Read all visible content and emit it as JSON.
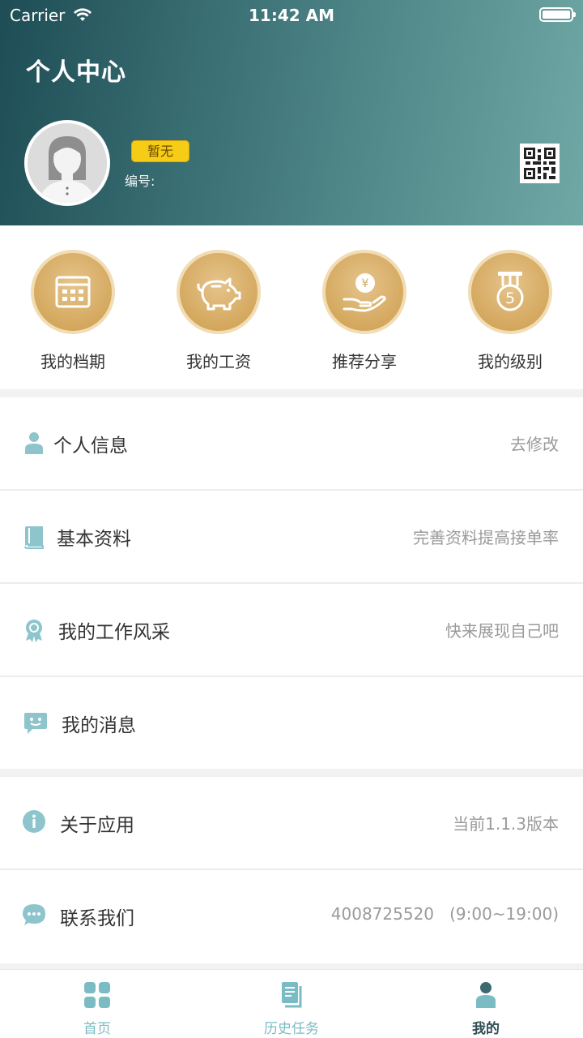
{
  "status_bar": {
    "carrier": "Carrier",
    "time": "11:42 AM"
  },
  "header": {
    "title": "个人中心",
    "level_badge": "暂无",
    "member_number_label": "编号:"
  },
  "quick_actions": [
    {
      "label": "我的档期",
      "icon": "calendar-icon"
    },
    {
      "label": "我的工资",
      "icon": "piggy-bank-icon"
    },
    {
      "label": "推荐分享",
      "icon": "hand-coin-icon"
    },
    {
      "label": "我的级别",
      "icon": "medal-icon"
    }
  ],
  "menu_group_1": [
    {
      "label": "个人信息",
      "hint": "去修改",
      "icon": "person-icon"
    },
    {
      "label": "基本资料",
      "hint": "完善资料提高接单率",
      "icon": "book-icon"
    },
    {
      "label": "我的工作风采",
      "hint": "快来展现自己吧",
      "icon": "award-icon"
    },
    {
      "label": "我的消息",
      "hint": "",
      "icon": "message-icon"
    }
  ],
  "menu_group_2": [
    {
      "label": "关于应用",
      "hint": "当前1.1.3版本",
      "icon": "info-icon"
    },
    {
      "label": "联系我们",
      "hint": "4008725520   (9:00~19:00)",
      "icon": "chat-icon"
    }
  ],
  "tab_bar": [
    {
      "label": "首页",
      "icon": "grid-icon"
    },
    {
      "label": "历史任务",
      "icon": "document-icon"
    },
    {
      "label": "我的",
      "icon": "user-icon",
      "active": true
    }
  ],
  "colors": {
    "header_start": "#1e4d55",
    "header_end": "#6fa8a5",
    "accent": "#7bbcc4",
    "gold": "#d4a85e",
    "badge": "#f7cc16"
  }
}
